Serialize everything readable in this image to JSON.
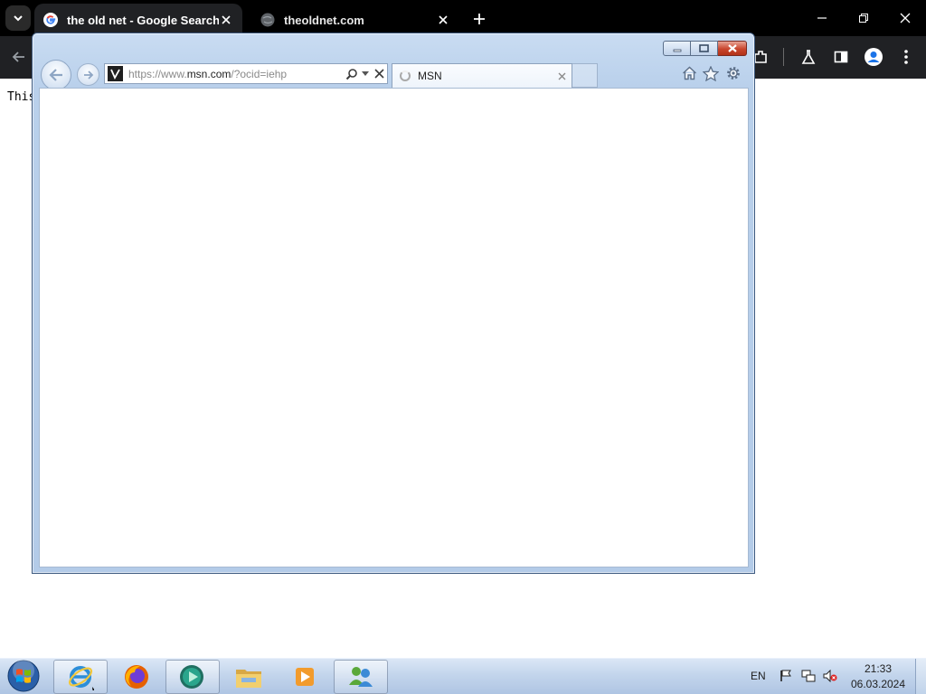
{
  "chrome": {
    "tabs": [
      {
        "title": "the old net - Google Search",
        "active": true
      },
      {
        "title": "theoldnet.com",
        "active": false
      }
    ],
    "page_text": "This"
  },
  "ie": {
    "address_prefix": "https://www.",
    "address_domain": "msn.com",
    "address_suffix": "/?ocid=iehp",
    "tab_title": "MSN"
  },
  "taskbar": {
    "apps": [
      "internet-explorer",
      "firefox",
      "media-app",
      "windows-explorer",
      "media-player",
      "messenger"
    ],
    "language": "EN",
    "time": "21:33",
    "date": "06.03.2024"
  }
}
